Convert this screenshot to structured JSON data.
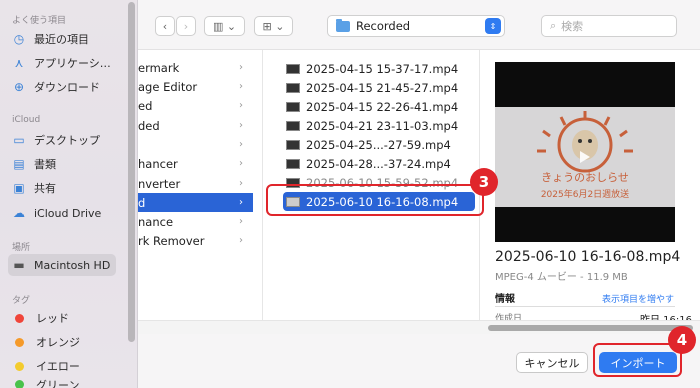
{
  "sidebar": {
    "favorites_heading": "よく使う項目",
    "favorites": [
      {
        "label": "最近の項目",
        "icon": "clock-icon"
      },
      {
        "label": "アプリケーシ…",
        "icon": "apps-icon"
      },
      {
        "label": "ダウンロード",
        "icon": "download-icon"
      }
    ],
    "icloud_heading": "iCloud",
    "icloud": [
      {
        "label": "デスクトップ",
        "icon": "desktop-icon"
      },
      {
        "label": "書類",
        "icon": "document-icon"
      },
      {
        "label": "共有",
        "icon": "shared-folder-icon"
      },
      {
        "label": "iCloud Drive",
        "icon": "cloud-icon"
      }
    ],
    "locations_heading": "場所",
    "locations": [
      {
        "label": "Macintosh HD",
        "icon": "disk-icon"
      }
    ],
    "tags_heading": "タグ",
    "tags": [
      {
        "label": "レッド",
        "color": "#f0453a"
      },
      {
        "label": "オレンジ",
        "color": "#f59a2a"
      },
      {
        "label": "イエロー",
        "color": "#f3cb2e"
      },
      {
        "label": "グリーン",
        "color": "#49c24b"
      }
    ]
  },
  "toolbar": {
    "back": "‹",
    "forward": "›",
    "view_icon": "▥ ⌄",
    "group_icon": "⊞ ⌄",
    "path": "Recorded",
    "search_placeholder": "検索"
  },
  "column1": {
    "items": [
      "ermark",
      "age Editor",
      "ed",
      "ded",
      "",
      "hancer",
      "nverter",
      "d",
      "nance",
      "rk Remover"
    ],
    "selected_index": 7
  },
  "column2": {
    "items": [
      "2025-04-15 15-37-17.mp4",
      "2025-04-15 21-45-27.mp4",
      "2025-04-15 22-26-41.mp4",
      "2025-04-21 23-11-03.mp4",
      "2025-04-25...-27-59.mp4",
      "2025-04-28...-37-24.mp4",
      "2025-06-10 15-59-52.mp4",
      "2025-06-10 16-16-08.mp4"
    ],
    "selected_index": 7
  },
  "preview": {
    "image_caption": "2025年6月2日週放送",
    "title": "2025-06-10 16-16-08.mp4",
    "subtitle": "MPEG-4 ムービー - 11.9 MB",
    "info_label": "情報",
    "more_link": "表示項目を増やす",
    "created_label": "作成日",
    "created_value": "昨日 16:16"
  },
  "buttons": {
    "cancel": "キャンセル",
    "import": "インポート"
  },
  "annotations": {
    "badge_3": "3",
    "badge_4": "4"
  },
  "colors": {
    "selection": "#2a64d6",
    "accent": "#2f7bf1",
    "annotation": "#e0252b"
  }
}
